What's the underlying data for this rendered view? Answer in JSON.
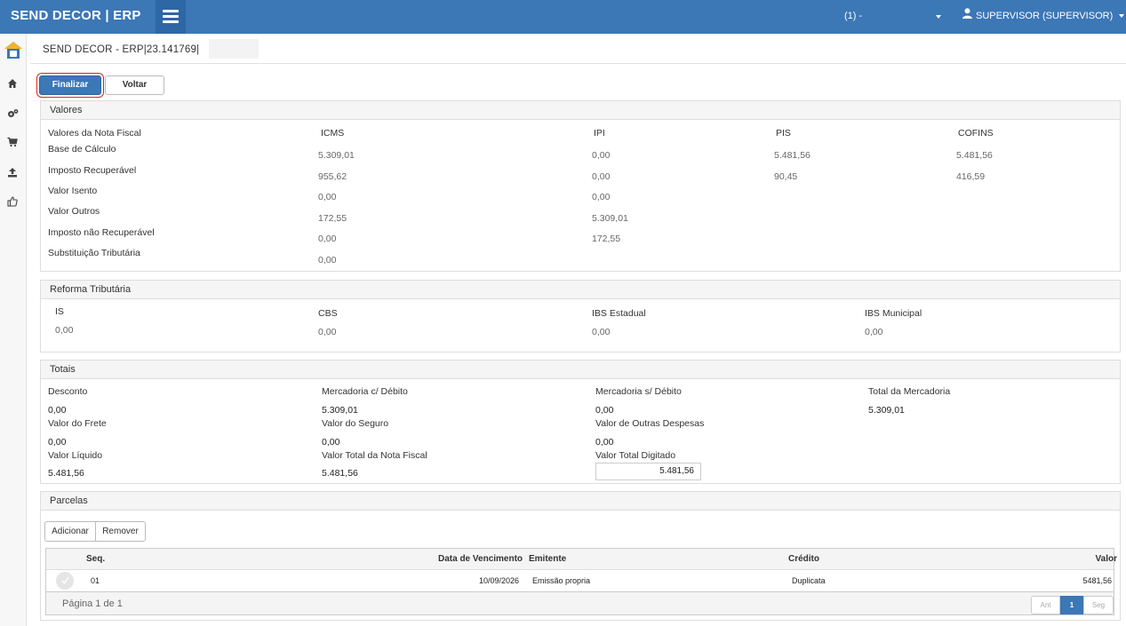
{
  "header": {
    "brand": "SEND DECOR | ERP",
    "company_selector": "(1) -",
    "user": "SUPERVISOR (SUPERVISOR)"
  },
  "page": {
    "title": "SEND DECOR - ERP|23.141769|"
  },
  "toolbar": {
    "finalize_label": "Finalizar",
    "back_label": "Voltar"
  },
  "valores": {
    "title": "Valores",
    "row_header": "Valores da Nota Fiscal",
    "columns": [
      "ICMS",
      "IPI",
      "PIS",
      "COFINS"
    ],
    "rows": [
      {
        "label": "Base de Cálculo",
        "icms": "5.309,01",
        "ipi": "0,00",
        "pis": "5.481,56",
        "cofins": "5.481,56"
      },
      {
        "label": "Imposto Recuperável",
        "icms": "955,62",
        "ipi": "0,00",
        "pis": "90,45",
        "cofins": "416,59"
      },
      {
        "label": "Valor Isento",
        "icms": "0,00",
        "ipi": "0,00"
      },
      {
        "label": "Valor Outros",
        "icms": "172,55",
        "ipi": "5.309,01"
      },
      {
        "label": "Imposto não Recuperável",
        "icms": "0,00",
        "ipi": "172,55"
      },
      {
        "label": "Substituição Tributária",
        "icms": "0,00"
      }
    ]
  },
  "reforma": {
    "title": "Reforma Tributária",
    "items": [
      {
        "label": "IS",
        "value": "0,00"
      },
      {
        "label": "CBS",
        "value": "0,00"
      },
      {
        "label": "IBS Estadual",
        "value": "0,00"
      },
      {
        "label": "IBS Municipal",
        "value": "0,00"
      }
    ]
  },
  "totais": {
    "title": "Totais",
    "fields": [
      {
        "label": "Desconto",
        "value": "0,00"
      },
      {
        "label": "Mercadoria c/ Débito",
        "value": "5.309,01"
      },
      {
        "label": "Mercadoria s/ Débito",
        "value": "0,00"
      },
      {
        "label": "Total da Mercadoria",
        "value": "5.309,01"
      },
      {
        "label": "Valor do Frete",
        "value": "0,00"
      },
      {
        "label": "Valor do Seguro",
        "value": "0,00"
      },
      {
        "label": "Valor de Outras Despesas",
        "value": "0,00"
      },
      {
        "label": "Valor Líquido",
        "value": "5.481,56"
      },
      {
        "label": "Valor Total da Nota Fiscal",
        "value": "5.481,56"
      },
      {
        "label": "Valor Total Digitado",
        "value": "5.481,56"
      }
    ]
  },
  "parcelas": {
    "title": "Parcelas",
    "add_label": "Adicionar",
    "remove_label": "Remover",
    "columns": {
      "seq": "Seq.",
      "due_date": "Data de Vencimento",
      "issuer": "Emitente",
      "credit": "Crédito",
      "value": "Valor"
    },
    "rows": [
      {
        "seq": "01",
        "due_date": "10/09/2026",
        "issuer": "Emissão propria",
        "credit": "Duplicata",
        "value": "5481,56"
      }
    ],
    "pager": {
      "text": "Página 1 de 1",
      "prev": "Ant",
      "current": "1",
      "next": "Seg"
    }
  },
  "colors": {
    "primary": "#3c77b6",
    "highlight_ring": "#e02020"
  },
  "icons": [
    "menu-icon",
    "user-icon",
    "logo-icon",
    "home-icon",
    "gears-icon",
    "cart-icon",
    "upload-icon",
    "thumbs-up-icon",
    "check-icon"
  ]
}
